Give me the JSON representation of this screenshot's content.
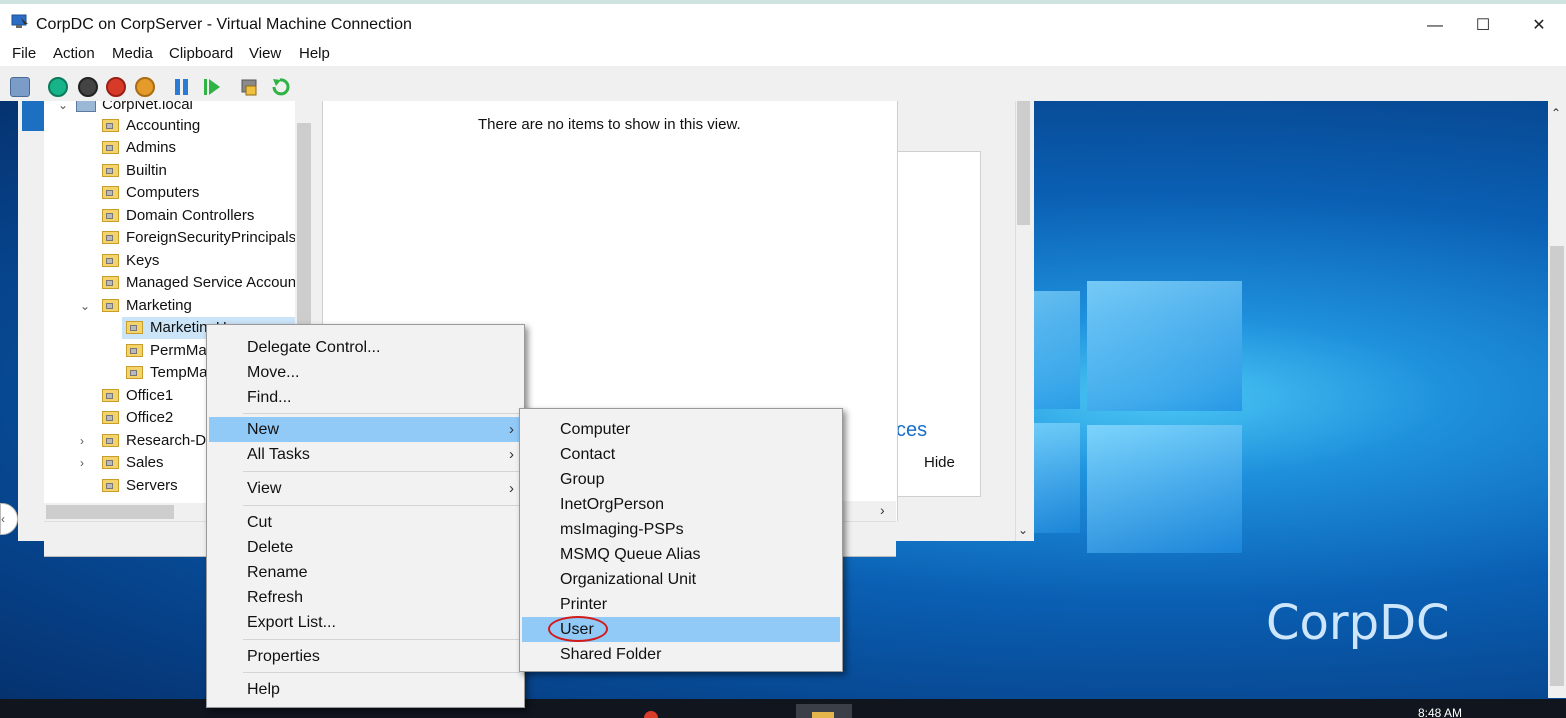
{
  "window": {
    "title": "CorpDC on CorpServer - Virtual Machine Connection",
    "minimize": "—",
    "maximize": "☐",
    "close": "✕"
  },
  "menubar": [
    "File",
    "Action",
    "Media",
    "Clipboard",
    "View",
    "Help"
  ],
  "toolbar": {
    "icons": [
      "ctrl-alt-del-icon",
      "start-icon",
      "turn-off-icon",
      "shutdown-icon",
      "save-icon",
      "pause-icon",
      "reset-icon",
      "checkpoint-icon",
      "revert-icon"
    ]
  },
  "tree": {
    "domain": "CorpNet.local",
    "items": [
      "Accounting",
      "Admins",
      "Builtin",
      "Computers",
      "Domain Controllers",
      "ForeignSecurityPrincipals",
      "Keys",
      "Managed Service Accounts",
      "Marketing",
      "MarketingU",
      "PermMar",
      "TempMar",
      "Office1",
      "Office2",
      "Research-De",
      "Sales",
      "Servers"
    ]
  },
  "details": {
    "empty_message": "There are no items to show in this view.",
    "services_text": "ces",
    "hide_text": "Hide"
  },
  "context_menu": {
    "items": [
      "Delegate Control...",
      "Move...",
      "Find...",
      "New",
      "All Tasks",
      "View",
      "Cut",
      "Delete",
      "Rename",
      "Refresh",
      "Export List...",
      "Properties",
      "Help"
    ],
    "highlighted": "New"
  },
  "submenu_new": {
    "items": [
      "Computer",
      "Contact",
      "Group",
      "InetOrgPerson",
      "msImaging-PSPs",
      "MSMQ Queue Alias",
      "Organizational Unit",
      "Printer",
      "User",
      "Shared Folder"
    ],
    "highlighted": "User"
  },
  "desktop": {
    "vm_name": "CorpDC",
    "clock": "8:48 AM"
  },
  "colors": {
    "highlight": "#91c9f7",
    "annotation": "#d21a1a",
    "wallpaper": "#0b5fad"
  }
}
